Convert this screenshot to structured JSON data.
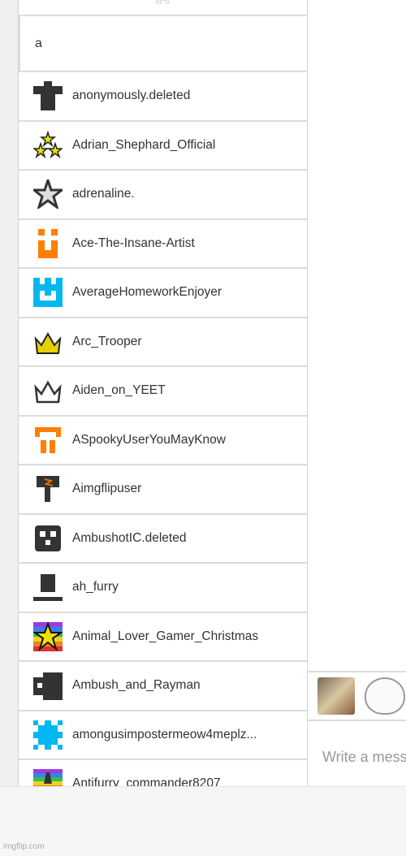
{
  "header": {
    "beta_label": "BETA"
  },
  "search": {
    "value": "a"
  },
  "users": [
    {
      "name": "anonymously.deleted",
      "icon": "shirt-icon",
      "color": "#333333"
    },
    {
      "name": "Adrian_Shephard_Official",
      "icon": "three-stars-icon",
      "color": "#e6e600"
    },
    {
      "name": "adrenaline.",
      "icon": "star-outline-icon",
      "color": "#333333"
    },
    {
      "name": "Ace-The-Insane-Artist",
      "icon": "smile-block-icon",
      "color": "#ff7f00"
    },
    {
      "name": "AverageHomeworkEnjoyer",
      "icon": "blue-block-icon",
      "color": "#00b7f0"
    },
    {
      "name": "Arc_Trooper",
      "icon": "gold-crown-icon",
      "color": "#e6d000"
    },
    {
      "name": "Aiden_on_YEET",
      "icon": "crown-outline-icon",
      "color": "#333333"
    },
    {
      "name": "ASpookyUserYouMayKnow",
      "icon": "orange-arch-icon",
      "color": "#ff7f00"
    },
    {
      "name": "Aimgflipuser",
      "icon": "hammer-icon",
      "color": "#333333"
    },
    {
      "name": "AmbushotIC.deleted",
      "icon": "skull-block-icon",
      "color": "#333333"
    },
    {
      "name": "ah_furry",
      "icon": "hat-icon",
      "color": "#333333"
    },
    {
      "name": "Animal_Lover_Gamer_Christmas",
      "icon": "rainbow-star-icon",
      "color": "#f0e000"
    },
    {
      "name": "Ambush_and_Rayman",
      "icon": "dark-block-icon",
      "color": "#333333"
    },
    {
      "name": "amongusimpostermeow4meplz...",
      "icon": "blue-gear-icon",
      "color": "#00b7f0"
    },
    {
      "name": "Antifurry_commander8207",
      "icon": "rainbow-glasses-icon",
      "color": "#333333"
    }
  ],
  "chat": {
    "placeholder": "Write a message"
  },
  "footer": {
    "watermark": "imgflip.com"
  }
}
